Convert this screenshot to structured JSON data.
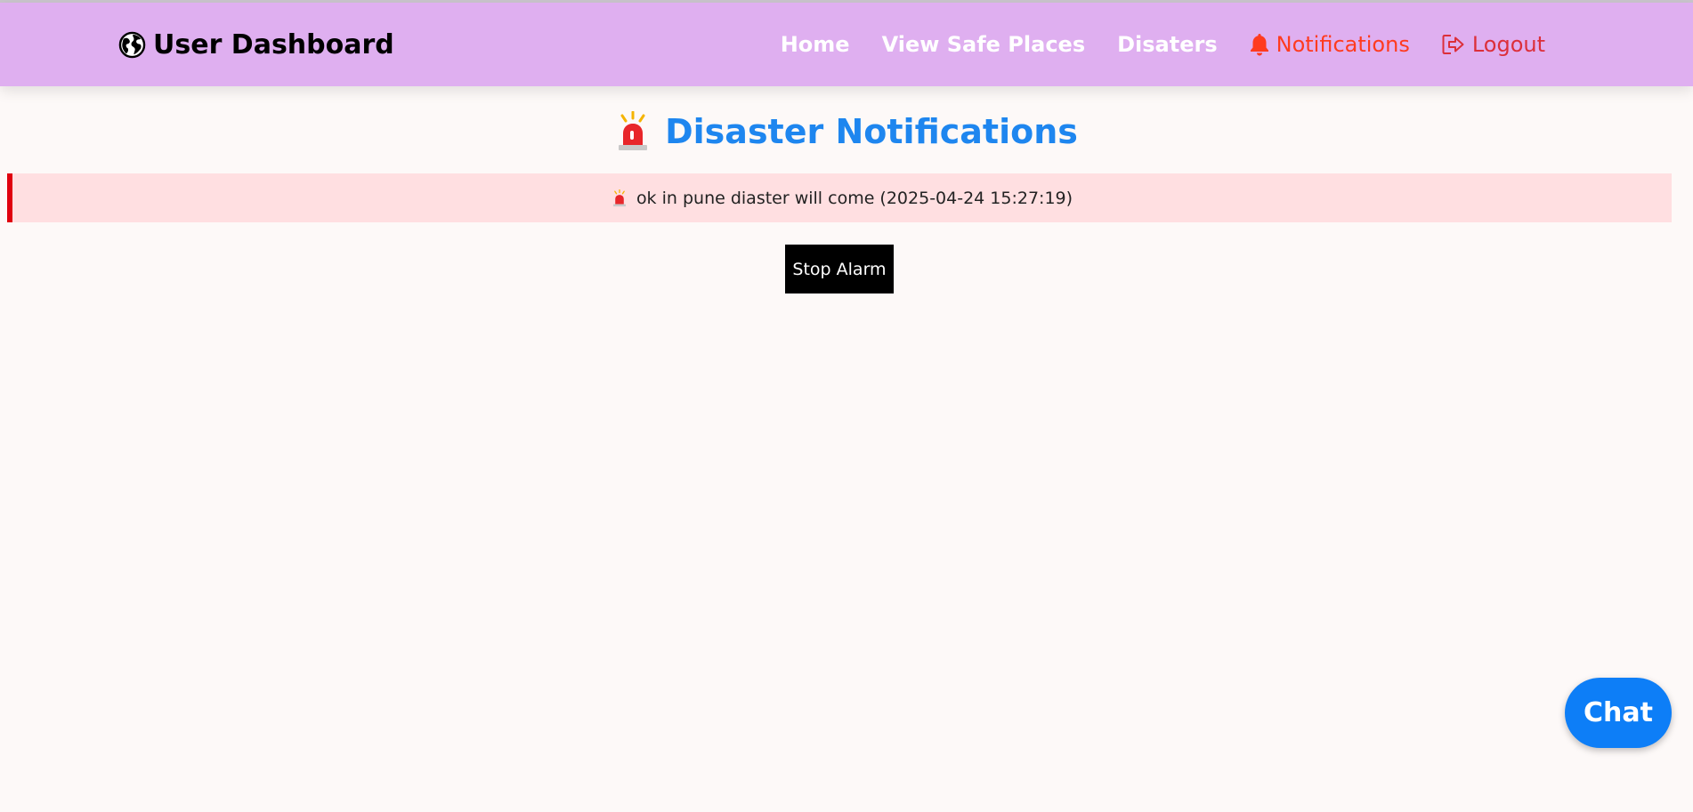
{
  "header": {
    "brand_icon": "globe-icon",
    "brand_text": "User Dashboard",
    "background_color": "#dfaff0"
  },
  "nav": {
    "home": "Home",
    "safe_places": "View Safe Places",
    "disasters": "Disaters",
    "notifications": "Notifications",
    "notifications_icon": "bell-icon",
    "notifications_color": "#ff3b1f",
    "logout": "Logout",
    "logout_icon": "logout-icon",
    "logout_color": "#dc2f3a"
  },
  "main": {
    "title_icon": "siren-icon",
    "title": "Disaster Notifications",
    "title_color": "#1e86ef",
    "notifications": [
      {
        "icon": "siren-icon",
        "text": "ok in pune diaster will come (2025-04-24 15:27:19)"
      }
    ],
    "stop_alarm_label": "Stop Alarm"
  },
  "chat": {
    "label": "Chat",
    "color": "#0d7ef7"
  }
}
